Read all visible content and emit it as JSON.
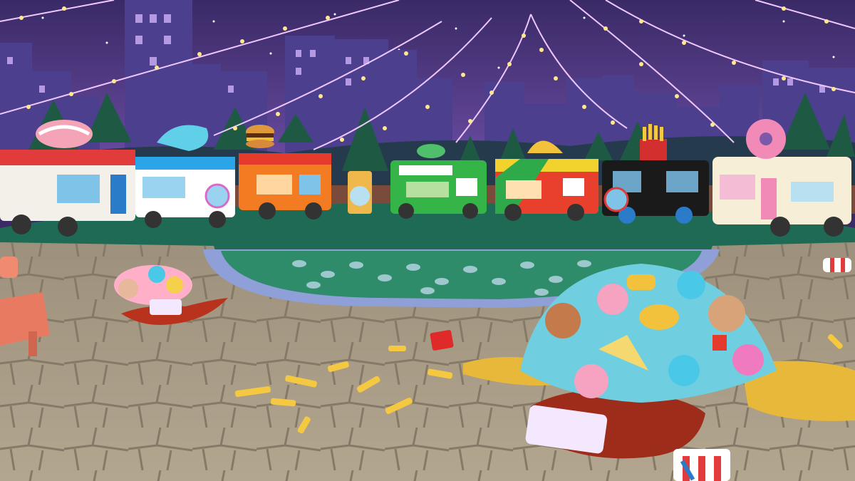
{
  "scene": {
    "kind": "3D food-truck plaza at night",
    "colors": {
      "sky_top": "#3a2a66",
      "sky_bottom": "#6f4fa8",
      "city": "#4b3f8e",
      "city_window": "#d9b8ff",
      "trees": "#1e5a43",
      "lawn": "#1f6a55",
      "pond": "#2f8c6a",
      "pavement": "#a89b86",
      "string_lights": "#ffe98a"
    }
  },
  "trucks": [
    {
      "name": "sushi-truck",
      "body": "#f3f0ea",
      "accent": "#e13b3b",
      "topper": "sushi"
    },
    {
      "name": "ice-cream-truck",
      "body": "#ffffff",
      "accent": "#2aa6e8",
      "topper": "ice-cream"
    },
    {
      "name": "burger-truck",
      "body": "#f37b22",
      "accent": "#e53a2c",
      "topper": "burger"
    },
    {
      "name": "salad-truck",
      "body": "#35b548",
      "accent": "#ffffff",
      "topper": "salad"
    },
    {
      "name": "taco-truck",
      "body": "#e8402c",
      "accent": "#f2d22c",
      "topper": "taco"
    },
    {
      "name": "fries-truck",
      "body": "#1a1a1a",
      "accent": "#d32f2f",
      "topper": "fries"
    },
    {
      "name": "donut-truck",
      "body": "#f7eed8",
      "accent": "#f28ab8",
      "topper": "donut"
    }
  ],
  "food_piles": [
    {
      "name": "small-food-pile",
      "size": "small"
    },
    {
      "name": "large-food-pile",
      "size": "large"
    }
  ],
  "props": [
    "ketchup-spill",
    "mustard-spill",
    "scattered-fries",
    "soda-cup",
    "ketchup-bottle",
    "picnic-bench",
    "map-kiosk"
  ]
}
